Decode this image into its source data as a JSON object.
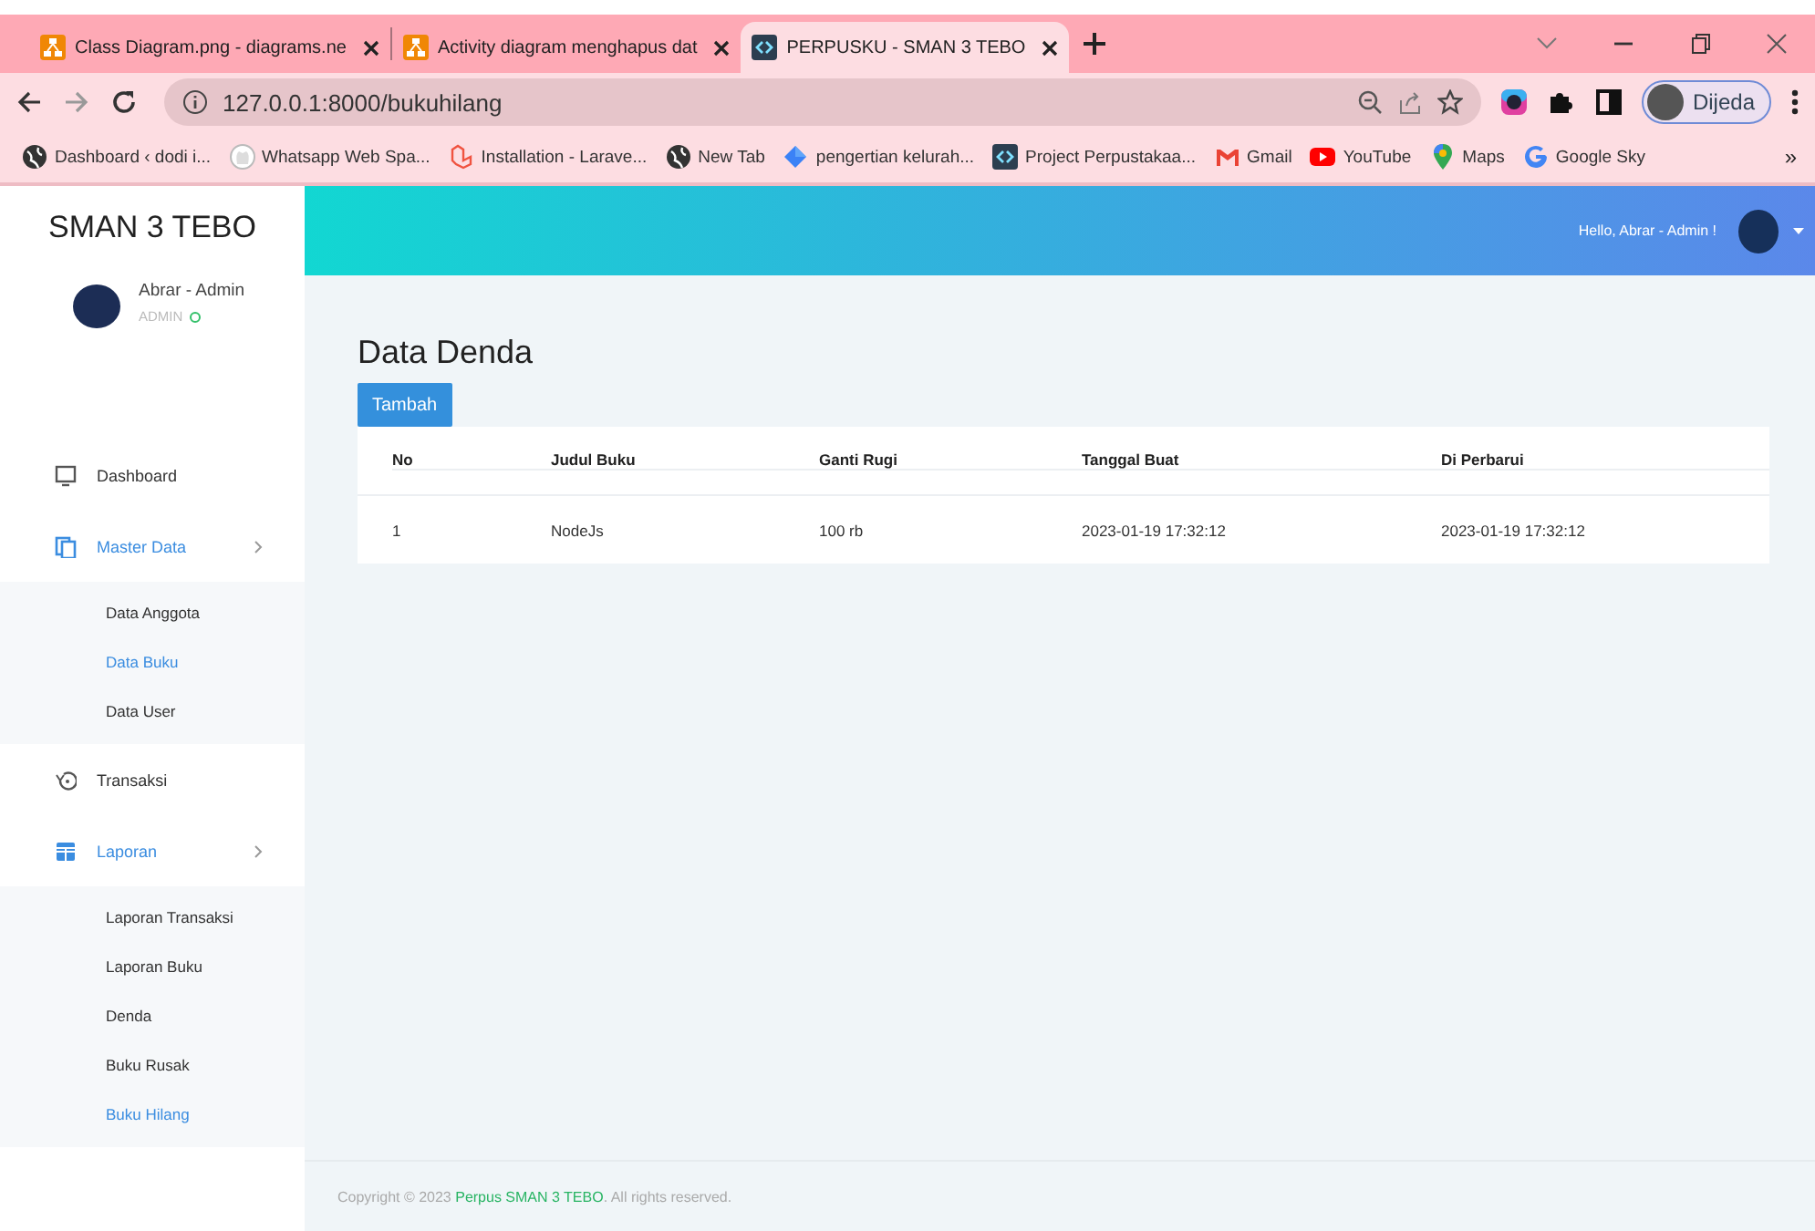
{
  "browser": {
    "tabs": [
      {
        "title": "Class Diagram.png - diagrams.ne",
        "selected": false
      },
      {
        "title": "Activity diagram menghapus dat",
        "selected": false
      },
      {
        "title": "PERPUSKU - SMAN 3 TEBO",
        "selected": true
      }
    ],
    "address": "127.0.0.1:8000/bukuhilang",
    "profile": "Dijeda",
    "bookmarks": [
      {
        "label": "Dashboard ‹ dodi i..."
      },
      {
        "label": "Whatsapp Web Spa..."
      },
      {
        "label": "Installation - Larave..."
      },
      {
        "label": "New Tab"
      },
      {
        "label": "pengertian kelurah..."
      },
      {
        "label": "Project Perpustakaa..."
      },
      {
        "label": "Gmail"
      },
      {
        "label": "YouTube"
      },
      {
        "label": "Maps"
      },
      {
        "label": "Google Sky"
      }
    ],
    "more": "»"
  },
  "sidebar": {
    "brand": "SMAN 3 TEBO",
    "user": {
      "name": "Abrar - Admin",
      "role": "ADMIN",
      "online": true
    },
    "menu": [
      {
        "label": "Dashboard",
        "active": false
      },
      {
        "label": "Master Data",
        "active": true,
        "expanded": true,
        "children": [
          {
            "label": "Data Anggota",
            "selected": false
          },
          {
            "label": "Data Buku",
            "selected": true
          },
          {
            "label": "Data User",
            "selected": false
          }
        ]
      },
      {
        "label": "Transaksi",
        "active": false
      },
      {
        "label": "Laporan",
        "active": true,
        "expanded": true,
        "children": [
          {
            "label": "Laporan Transaksi",
            "selected": false
          },
          {
            "label": "Laporan Buku",
            "selected": false
          },
          {
            "label": "Denda",
            "selected": false
          },
          {
            "label": "Buku Rusak",
            "selected": false
          },
          {
            "label": "Buku Hilang",
            "selected": true
          }
        ]
      }
    ]
  },
  "header": {
    "greeting": "Hello, Abrar - Admin !"
  },
  "content": {
    "title": "Data Denda",
    "add_button": "Tambah",
    "table": {
      "columns": [
        "No",
        "Judul Buku",
        "Ganti Rugi",
        "Tanggal Buat",
        "Di Perbarui"
      ],
      "rows": [
        [
          "1",
          "NodeJs",
          "100 rb",
          "2023-01-19 17:32:12",
          "2023-01-19 17:32:12"
        ]
      ]
    }
  },
  "footer": {
    "prefix": "Copyright © 2023",
    "link": "Perpus SMAN 3 TEBO",
    "suffix": ". All rights reserved."
  }
}
